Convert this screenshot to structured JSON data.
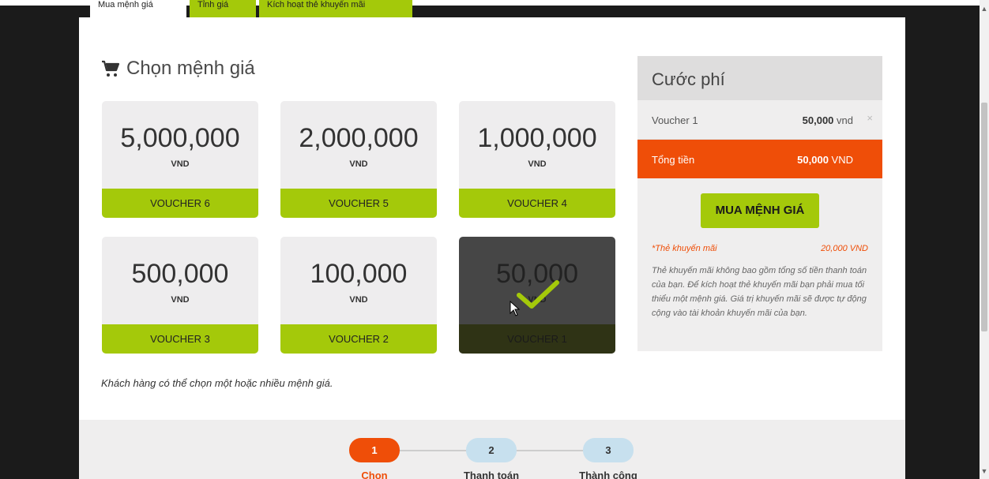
{
  "tabs": [
    "Mua mệnh giá",
    "Tỉnh giá",
    "Kích hoạt thẻ khuyến mãi"
  ],
  "section": {
    "title": "Chọn mệnh giá",
    "icon": "shopping-cart-icon"
  },
  "cards": [
    {
      "amount": "5,000,000",
      "unit": "VND",
      "voucher": "VOUCHER 6",
      "selected": false
    },
    {
      "amount": "2,000,000",
      "unit": "VND",
      "voucher": "VOUCHER 5",
      "selected": false
    },
    {
      "amount": "1,000,000",
      "unit": "VND",
      "voucher": "VOUCHER 4",
      "selected": false
    },
    {
      "amount": "500,000",
      "unit": "VND",
      "voucher": "VOUCHER 3",
      "selected": false
    },
    {
      "amount": "100,000",
      "unit": "VND",
      "voucher": "VOUCHER 2",
      "selected": false
    },
    {
      "amount": "50,000",
      "unit": "VND",
      "voucher": "VOUCHER 1",
      "selected": true
    }
  ],
  "hint": "Khách hàng có thể chọn một hoặc nhiều mệnh giá.",
  "summary": {
    "title": "Cước phí",
    "line_name": "Voucher 1",
    "line_amount": "50,000",
    "line_unit": "vnd",
    "remove_glyph": "×",
    "total_label": "Tổng tiền",
    "total_amount": "50,000",
    "total_unit": "VND",
    "buy_button": "MUA MỆNH GIÁ",
    "promo_label": "*Thẻ khuyến mãi",
    "promo_value": "20,000 VND",
    "promo_note": "Thẻ khuyến mãi không bao gồm tổng số tiền thanh toán của bạn. Để kích hoạt thẻ khuyến mãi bạn phải mua tối thiểu một mệnh giá. Giá trị khuyến mãi sẽ được tự động cộng vào tài khoản khuyến mãi của bạn."
  },
  "steps": [
    {
      "number": "1",
      "label": "Chọn",
      "state": "active"
    },
    {
      "number": "2",
      "label": "Thanh toán",
      "state": "pending"
    },
    {
      "number": "3",
      "label": "Thành công",
      "state": "pending"
    }
  ],
  "colors": {
    "accent_green": "#a4c90a",
    "accent_orange": "#ef4e08",
    "card_bg": "#eeedee",
    "selected_card_bg": "#464646",
    "step_pending": "#c7e0ee"
  }
}
